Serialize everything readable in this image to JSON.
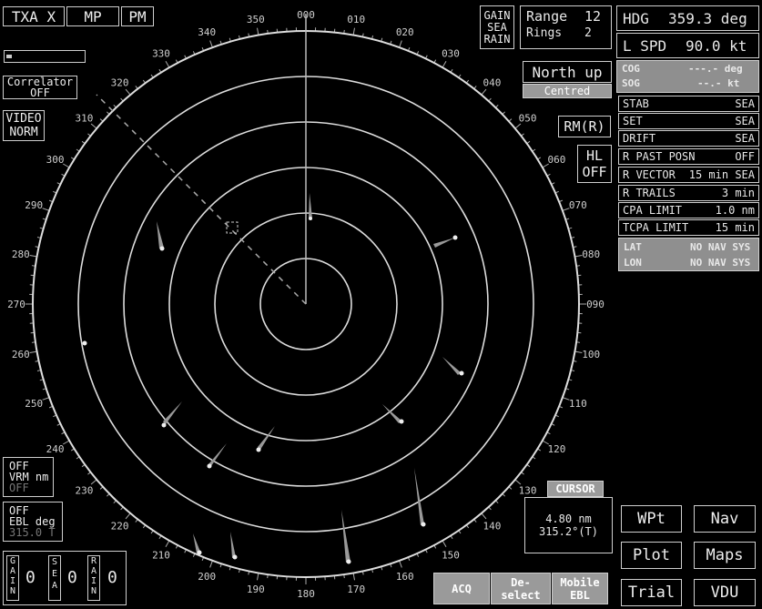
{
  "top_left": {
    "txa": "TXA X",
    "mp": "MP",
    "pm": "PM"
  },
  "correlator": {
    "l1": "Correlator",
    "l2": "OFF"
  },
  "video": {
    "l1": "VIDEO",
    "l2": "NORM"
  },
  "vrm": {
    "l1": "OFF",
    "l2": "VRM nm",
    "l3": "OFF"
  },
  "ebl": {
    "l1": "OFF",
    "l2": "EBL deg",
    "l3": "315.0 T"
  },
  "gain_controls": {
    "gain": "G A I N",
    "gain_val": "0",
    "sea": "S E A",
    "sea_val": "0",
    "rain": "R A I N",
    "rain_val": "0"
  },
  "gsr": {
    "l1": "GAIN",
    "l2": "SEA",
    "l3": "RAIN"
  },
  "range": {
    "label": "Range",
    "value": "12",
    "rings_label": "Rings",
    "rings_value": "2"
  },
  "orientation": {
    "mode": "North up",
    "centred": "Centred"
  },
  "rm": "RM(R)",
  "hl": {
    "l1": "HL",
    "l2": "OFF"
  },
  "hdg": {
    "label": "HDG",
    "value": "359.3 deg"
  },
  "lspd": {
    "label": "L SPD",
    "value": "90.0 kt"
  },
  "cog": {
    "label": "COG",
    "value": "---.- deg"
  },
  "sog": {
    "label": "SOG",
    "value": "--.- kt"
  },
  "status_rows": [
    {
      "label": "STAB",
      "value": "SEA"
    },
    {
      "label": "SET",
      "value": "SEA"
    },
    {
      "label": "DRIFT",
      "value": "SEA"
    },
    {
      "label": "R PAST POSN",
      "value": "OFF"
    },
    {
      "label": "R VECTOR",
      "value": "15 min SEA"
    },
    {
      "label": "R TRAILS",
      "value": "3 min"
    },
    {
      "label": "CPA LIMIT",
      "value": "1.0 nm"
    },
    {
      "label": "TCPA LIMIT",
      "value": "15 min"
    }
  ],
  "lat": {
    "label": "LAT",
    "value": "NO NAV SYS"
  },
  "lon": {
    "label": "LON",
    "value": "NO NAV SYS"
  },
  "cursor": {
    "title": "CURSOR",
    "range": "4.80 nm",
    "bearing": "315.2°(T)"
  },
  "buttons": {
    "wpt": "WPt",
    "nav": "Nav",
    "plot": "Plot",
    "maps": "Maps",
    "trial": "Trial",
    "vdu": "VDU"
  },
  "bottom_buttons": {
    "acq": "ACQ",
    "deselect_1": "De-",
    "deselect_2": "select",
    "mobile_1": "Mobile",
    "mobile_2": "EBL"
  },
  "bearing_labels": [
    "000",
    "010",
    "020",
    "030",
    "040",
    "050",
    "060",
    "070",
    "080",
    "090",
    "100",
    "110",
    "120",
    "130",
    "140",
    "150",
    "160",
    "170",
    "180",
    "190",
    "200",
    "210",
    "220",
    "230",
    "240",
    "250",
    "260",
    "270",
    "280",
    "290",
    "300",
    "310",
    "320",
    "330",
    "340",
    "350"
  ]
}
